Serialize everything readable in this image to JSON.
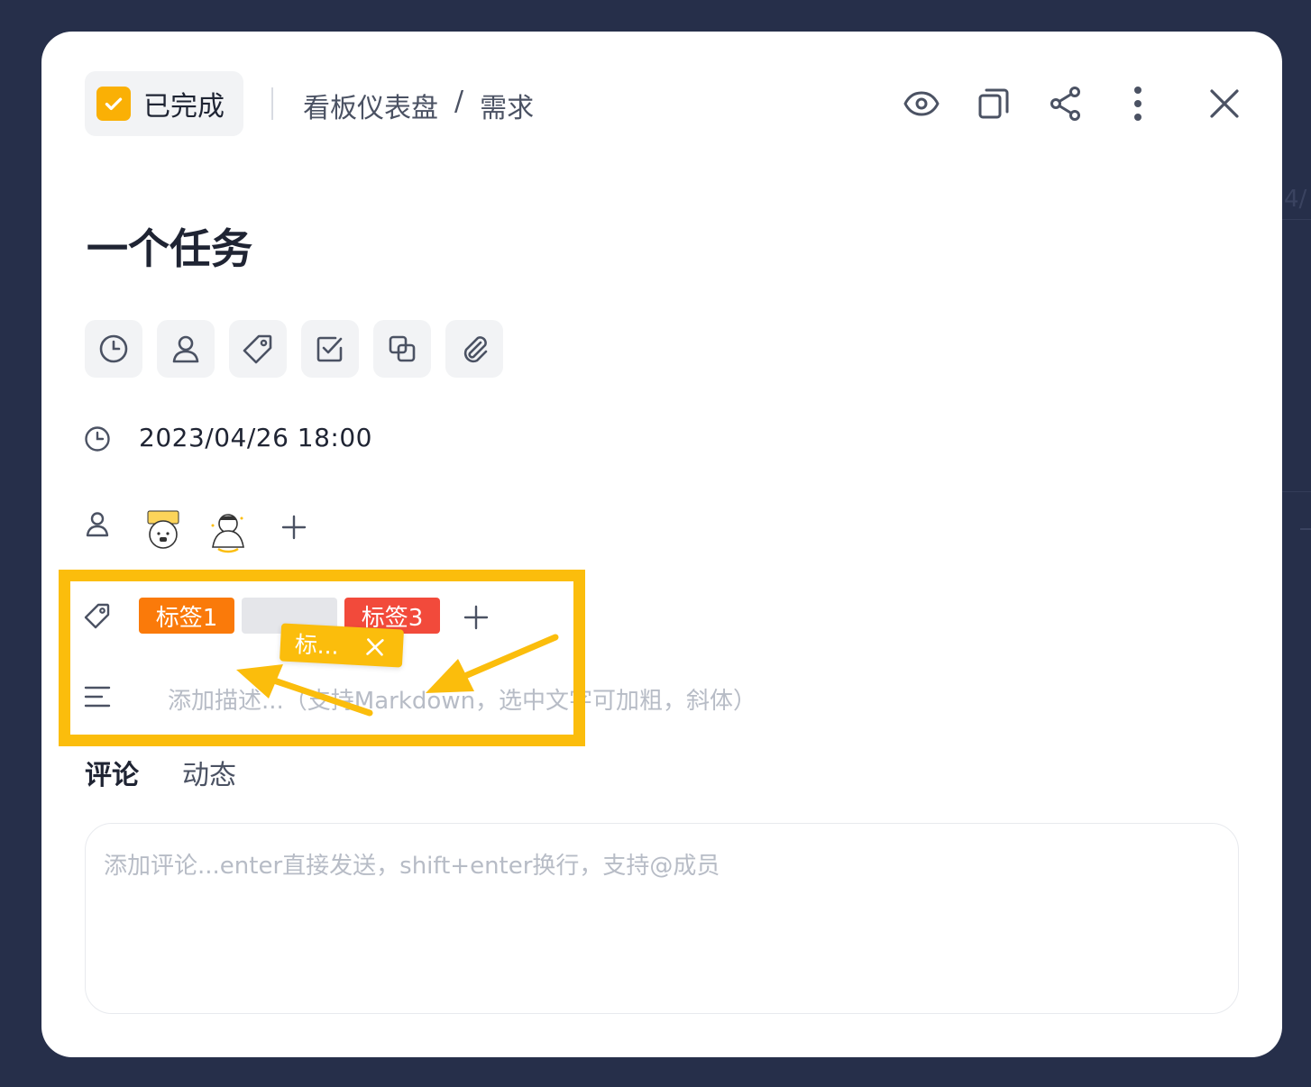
{
  "background": {
    "peek_text": "4/"
  },
  "header": {
    "status_label": "已完成",
    "breadcrumb": {
      "board": "看板仪表盘",
      "separator": "/",
      "section": "需求"
    },
    "icons": [
      "eye-icon",
      "duplicate-icon",
      "share-icon",
      "more-vertical-icon",
      "close-icon"
    ]
  },
  "task": {
    "title": "一个任务"
  },
  "toolbar": {
    "icons": [
      "clock-icon",
      "user-icon",
      "tag-icon",
      "checklist-icon",
      "copy-icon",
      "attachment-icon"
    ]
  },
  "fields": {
    "due_date": "2023/04/26 18:00",
    "tags": [
      {
        "label": "标签1",
        "color": "#fa7a0a"
      },
      {
        "label": "标签3",
        "color": "#f24a3b"
      }
    ],
    "dragging_tag": {
      "label": "标...",
      "color": "#fbbd0c"
    },
    "description_placeholder": "添加描述...（支持Markdown，选中文字可加粗，斜体）"
  },
  "tabs": [
    {
      "label": "评论",
      "active": true
    },
    {
      "label": "动态",
      "active": false
    }
  ],
  "comment": {
    "placeholder": "添加评论...enter直接发送，shift+enter换行，支持@成员"
  },
  "colors": {
    "accent": "#fbbd0c",
    "modal_bg": "#ffffff",
    "page_bg": "#262f4a"
  }
}
